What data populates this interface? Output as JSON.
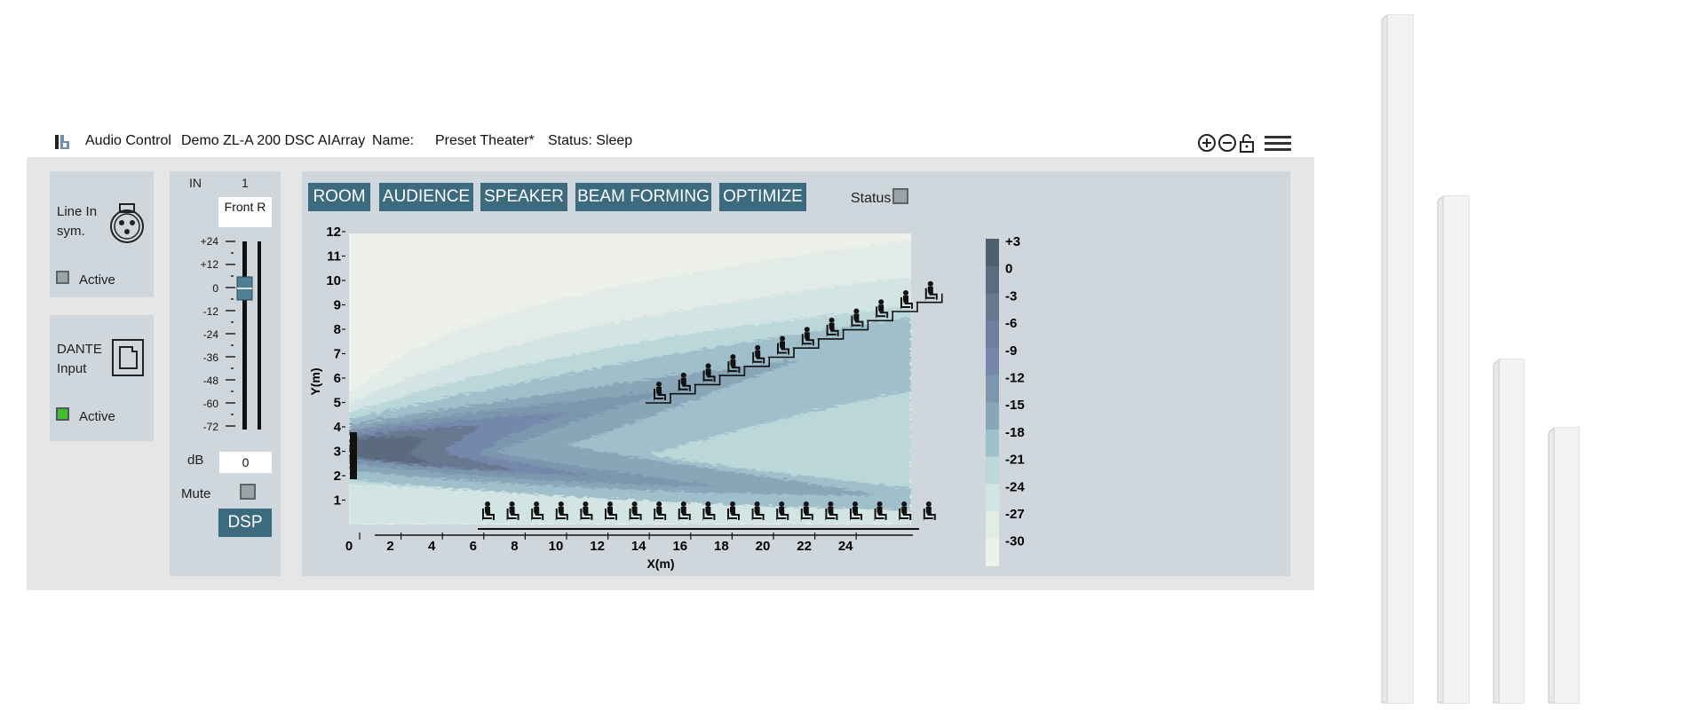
{
  "header": {
    "app_title": "Audio Control",
    "device": "Demo ZL-A 200 DSC AIArray",
    "name_label": "Name:",
    "preset": "Preset Theater*",
    "status": "Status: Sleep"
  },
  "inputs": {
    "line_in": {
      "label_line1": "Line In",
      "label_line2": "sym.",
      "active_label": "Active",
      "active": false
    },
    "dante": {
      "label_line1": "DANTE",
      "label_line2": "Input",
      "active_label": "Active",
      "active": true
    }
  },
  "channel": {
    "in_label": "IN",
    "in_number": "1",
    "channel_name": "Front R",
    "scale": [
      "+24",
      "+12",
      "0",
      "-12",
      "-24",
      "-36",
      "-48",
      "-60",
      "-72"
    ],
    "db_label": "dB",
    "db_value": "0",
    "mute_label": "Mute",
    "mute_checked": false,
    "dsp_label": "DSP"
  },
  "tabs": [
    "ROOM",
    "AUDIENCE",
    "SPEAKER",
    "BEAM FORMING",
    "OPTIMIZE"
  ],
  "status_label": "Status",
  "plot": {
    "x_label": "X(m)",
    "y_label": "Y(m)",
    "x_ticks": [
      "0",
      "2",
      "4",
      "6",
      "8",
      "10",
      "12",
      "14",
      "16",
      "18",
      "20",
      "22",
      "24"
    ],
    "y_ticks": [
      "1",
      "2",
      "3",
      "4",
      "5",
      "6",
      "7",
      "8",
      "9",
      "10",
      "11",
      "12"
    ],
    "colorbar_labels": [
      "+3",
      "0",
      "-3",
      "-6",
      "-9",
      "-12",
      "-15",
      "-18",
      "-21",
      "-24",
      "-27",
      "-30"
    ],
    "colorbar_colors": [
      "#4e5e6e",
      "#5b6b80",
      "#67788f",
      "#6f7fa0",
      "#7587ab",
      "#7b96ad",
      "#89a6b8",
      "#9fbfcb",
      "#bcd7da",
      "#d2e5e2",
      "#e3ebe6",
      "#eef0ec"
    ]
  },
  "colors": {
    "accent": "#3c6b80",
    "panel": "#cfd7dc",
    "frame": "#e6e6e6"
  },
  "icons": [
    "logo-icon",
    "zoom-in-icon",
    "zoom-out-icon",
    "lock-icon",
    "menu-icon",
    "xlr-connector-icon",
    "network-port-icon",
    "seated-person-icon",
    "speaker-column-icon"
  ]
}
